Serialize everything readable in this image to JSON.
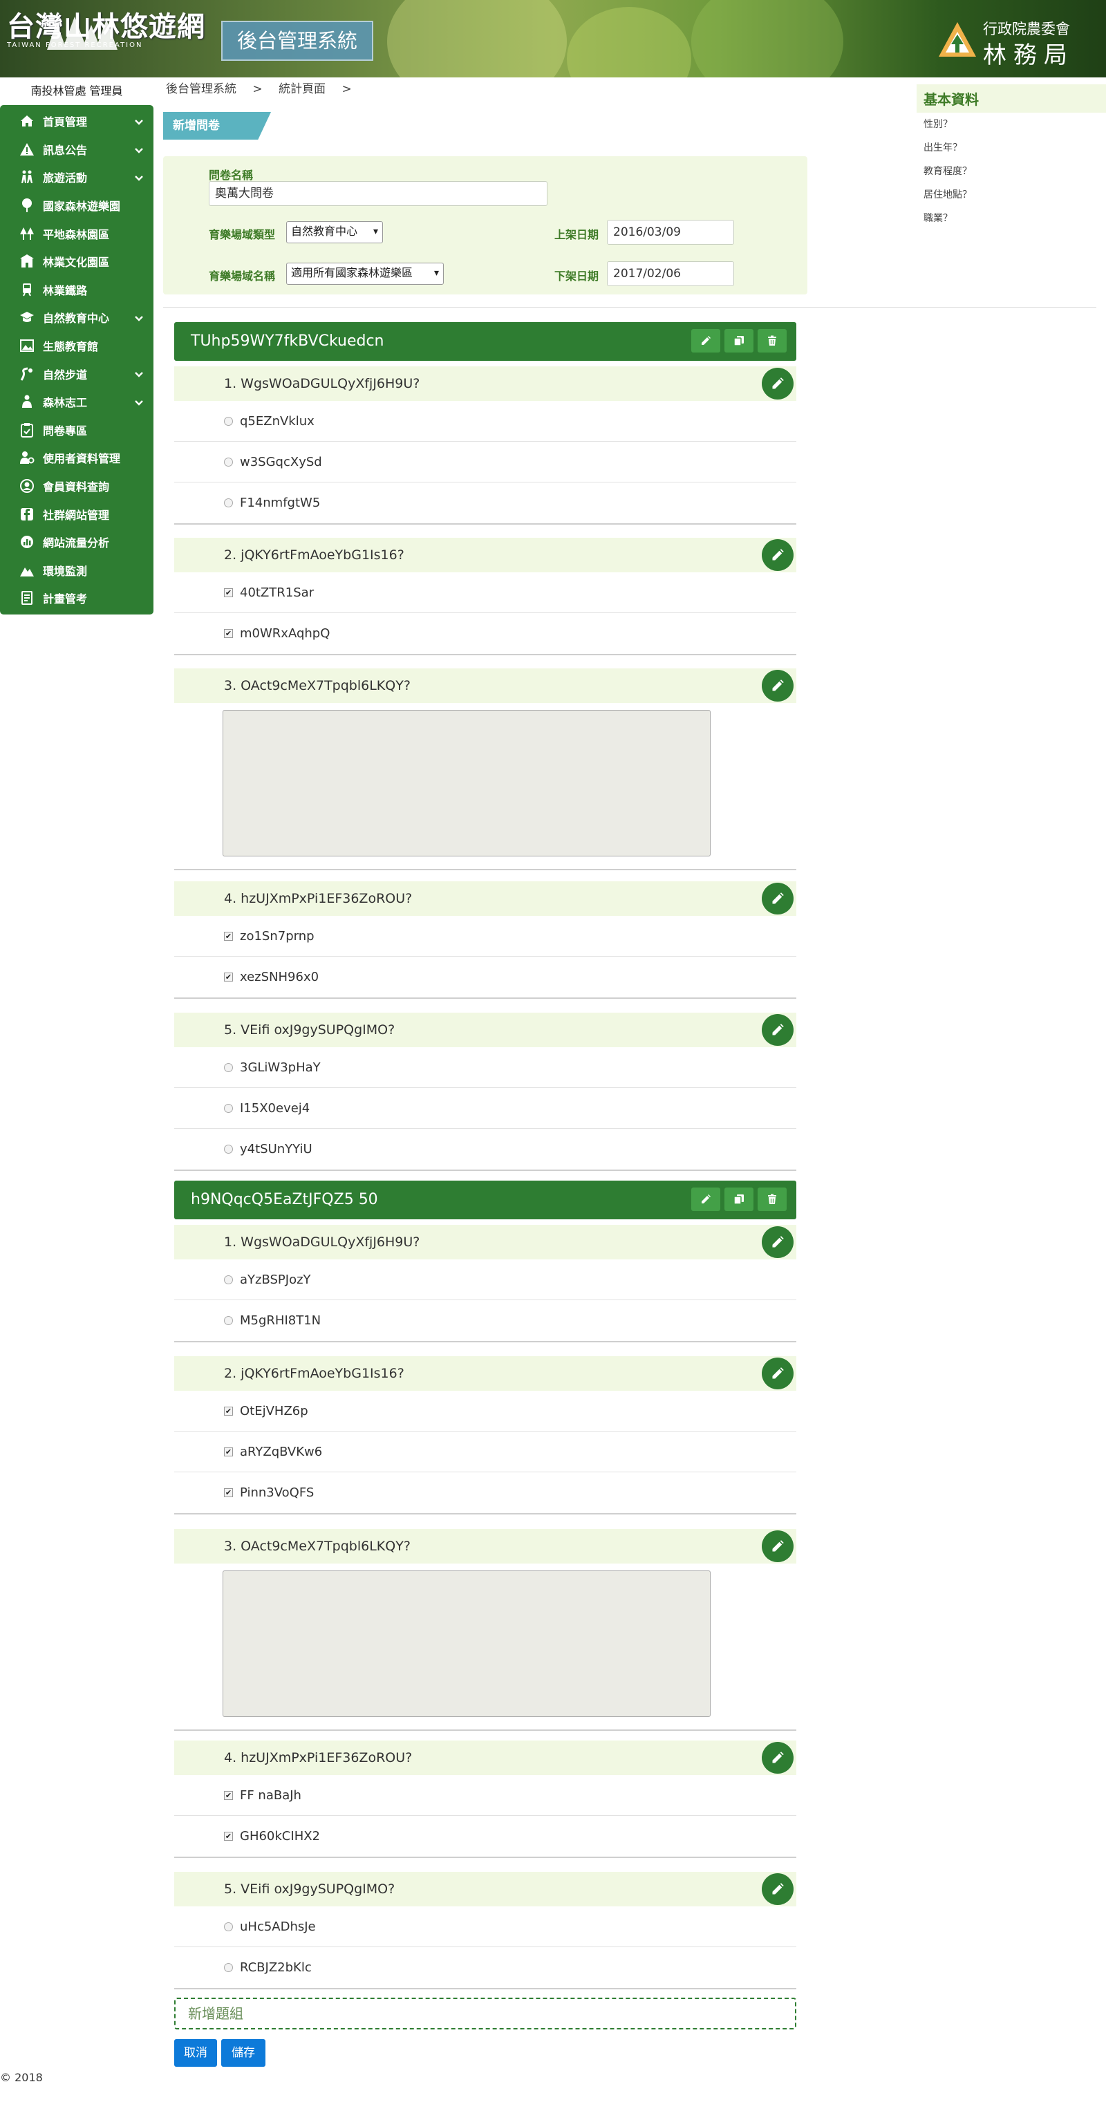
{
  "header": {
    "logo_text": "台灣山林悠遊網",
    "logo_sub": "TAIWAN FOREST RECREATION",
    "system_title": "後台管理系統",
    "agency_line1": "行政院農委會",
    "agency_line2": "林務局"
  },
  "sidebar": {
    "user": "南投林管處 管理員",
    "items": [
      {
        "label": "首頁管理",
        "icon": "home-icon",
        "chevron": true
      },
      {
        "label": "訊息公告",
        "icon": "warning-icon",
        "chevron": true
      },
      {
        "label": "旅遊活動",
        "icon": "hiking-icon",
        "chevron": true
      },
      {
        "label": "國家森林遊樂園",
        "icon": "tree-icon",
        "chevron": false
      },
      {
        "label": "平地森林園區",
        "icon": "forest-park-icon",
        "chevron": false
      },
      {
        "label": "林業文化園區",
        "icon": "building-icon",
        "chevron": false
      },
      {
        "label": "林業鐵路",
        "icon": "train-icon",
        "chevron": false
      },
      {
        "label": "自然教育中心",
        "icon": "graduation-icon",
        "chevron": true
      },
      {
        "label": "生態教育館",
        "icon": "gallery-icon",
        "chevron": false
      },
      {
        "label": "自然步道",
        "icon": "trail-icon",
        "chevron": true
      },
      {
        "label": "森林志工",
        "icon": "volunteer-icon",
        "chevron": true
      },
      {
        "label": "問卷專區",
        "icon": "clipboard-icon",
        "chevron": false
      },
      {
        "label": "使用者資料管理",
        "icon": "user-gear-icon",
        "chevron": false
      },
      {
        "label": "會員資料查詢",
        "icon": "user-circle-icon",
        "chevron": false
      },
      {
        "label": "社群網站管理",
        "icon": "facebook-icon",
        "chevron": false
      },
      {
        "label": "網站流量分析",
        "icon": "chart-icon",
        "chevron": false
      },
      {
        "label": "環境監測",
        "icon": "mountain-icon",
        "chevron": false
      },
      {
        "label": "計畫管考",
        "icon": "report-icon",
        "chevron": false
      }
    ]
  },
  "breadcrumb": [
    "後台管理系統",
    ">",
    "統計頁面",
    ">"
  ],
  "new_tag": "新增問卷",
  "form": {
    "name_label": "問卷名稱",
    "name_value": "奧萬大問卷",
    "type_label": "育樂場域類型",
    "type_value": "自然教育中心",
    "place_label": "育樂場域名稱",
    "place_value": "適用所有國家森林遊樂區",
    "start_label": "上架日期",
    "start_value": "2016/03/09",
    "end_label": "下架日期",
    "end_value": "2017/02/06"
  },
  "right_panel": {
    "title": "基本資料",
    "items": [
      "性別？",
      "出生年？",
      "教育程度？",
      "居住地點？",
      "職業？"
    ]
  },
  "groups": [
    {
      "title": "TUhp59WY7fkBVCkuedcn",
      "questions": [
        {
          "text": "1. WgsWOaDGULQyXfjJ6H9U?",
          "type": "radio",
          "options": [
            "q5EZnVklux",
            "w3SGqcXySd",
            "F14nmfgtW5"
          ]
        },
        {
          "text": "2. jQKY6rtFmAoeYbG1Is16?",
          "type": "check",
          "options": [
            "40tZTR1Sar",
            "m0WRxAqhpQ"
          ]
        },
        {
          "text": "3. OAct9cMeX7Tpqbl6LKQY?",
          "type": "text",
          "options": []
        },
        {
          "text": "4. hzUJXmPxPi1EF36ZoROU?",
          "type": "check",
          "options": [
            "zo1Sn7prnp",
            "xezSNH96x0"
          ]
        },
        {
          "text": "5. VEifi oxJ9gySUPQgIMO?",
          "type": "radio",
          "options": [
            "3GLiW3pHaY",
            "I15X0evej4",
            "y4tSUnYYiU"
          ]
        }
      ]
    },
    {
      "title": "h9NQqcQ5EaZtJFQZ5 50",
      "questions": [
        {
          "text": "1. WgsWOaDGULQyXfjJ6H9U?",
          "type": "radio",
          "options": [
            "aYzBSPJozY",
            "M5gRHI8T1N"
          ]
        },
        {
          "text": "2. jQKY6rtFmAoeYbG1Is16?",
          "type": "check",
          "options": [
            "OtEjVHZ6p",
            "aRYZqBVKw6",
            "Pinn3VoQFS"
          ]
        },
        {
          "text": "3. OAct9cMeX7Tpqbl6LKQY?",
          "type": "text",
          "options": []
        },
        {
          "text": "4. hzUJXmPxPi1EF36ZoROU?",
          "type": "check",
          "options": [
            "FF naBaJh",
            "GH60kCIHX2"
          ]
        },
        {
          "text": "5. VEifi oxJ9gySUPQgIMO?",
          "type": "radio",
          "options": [
            "uHc5ADhsJe",
            "RCBJZ2bKlc"
          ]
        }
      ]
    }
  ],
  "add_group": "新增題組",
  "buttons": {
    "cancel": "取消",
    "save": "儲存"
  },
  "footer": "© 2018",
  "colors": {
    "primary_green": "#2e7d32",
    "light_green_bg": "#f1f8e2",
    "teal_tag": "#5bb3c0",
    "blue_button": "#0d7ad9"
  }
}
